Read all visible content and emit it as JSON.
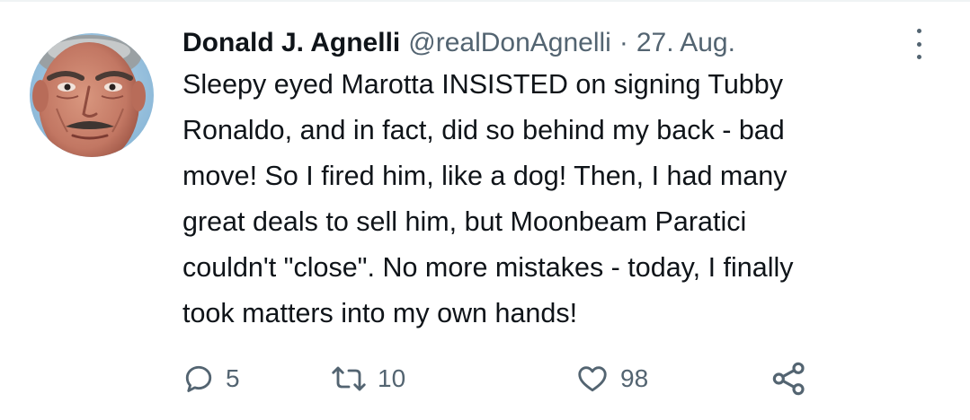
{
  "tweet": {
    "author_name": "Donald J. Agnelli",
    "handle": "@realDonAgnelli",
    "separator": "·",
    "date": "27. Aug.",
    "text_lines": [
      "Sleepy eyed Marotta INSISTED on signing Tubby",
      "Ronaldo, and in fact, did so behind my back - bad",
      "move! So I fired him, like a dog! Then, I had many",
      "great deals to sell him, but Moonbeam Paratici",
      "couldn't \"close\". No more mistakes - today, I finally",
      "took matters into my own hands!"
    ]
  },
  "actions": {
    "reply": {
      "icon": "reply-icon",
      "count": "5"
    },
    "retweet": {
      "icon": "retweet-icon",
      "count": "10"
    },
    "like": {
      "icon": "heart-icon",
      "count": "98"
    },
    "share": {
      "icon": "share-icon",
      "count": ""
    }
  },
  "more_menu": {
    "icon": "more-vertical-icon"
  },
  "colors": {
    "text_primary": "#0f1419",
    "text_secondary": "#536471",
    "divider": "#eff3f4",
    "background": "#ffffff"
  }
}
